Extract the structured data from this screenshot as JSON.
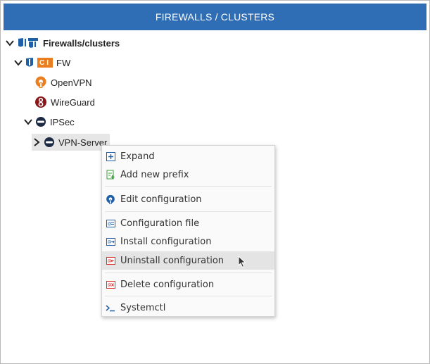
{
  "header": {
    "title": "FIREWALLS / CLUSTERS"
  },
  "tree": {
    "root_label": "Firewalls/clusters",
    "fw_badge": "CI",
    "fw_label": "FW",
    "openvpn_label": "OpenVPN",
    "wireguard_label": "WireGuard",
    "ipsec_label": "IPSec",
    "vpn_server_label": "VPN-Server"
  },
  "context_menu": {
    "expand": "Expand",
    "add_prefix": "Add new prefix",
    "edit_config": "Edit configuration",
    "config_file": "Configuration file",
    "install_config": "Install configuration",
    "uninstall_config": "Uninstall configuration",
    "delete_config": "Delete configuration",
    "systemctl": "Systemctl"
  },
  "colors": {
    "header_bg": "#2f6db5",
    "icon_blue": "#1f5fa8",
    "openvpn_orange": "#ea7e20",
    "wireguard_red": "#88171a",
    "delete_red": "#d9302a",
    "add_green": "#3a9a3a"
  }
}
